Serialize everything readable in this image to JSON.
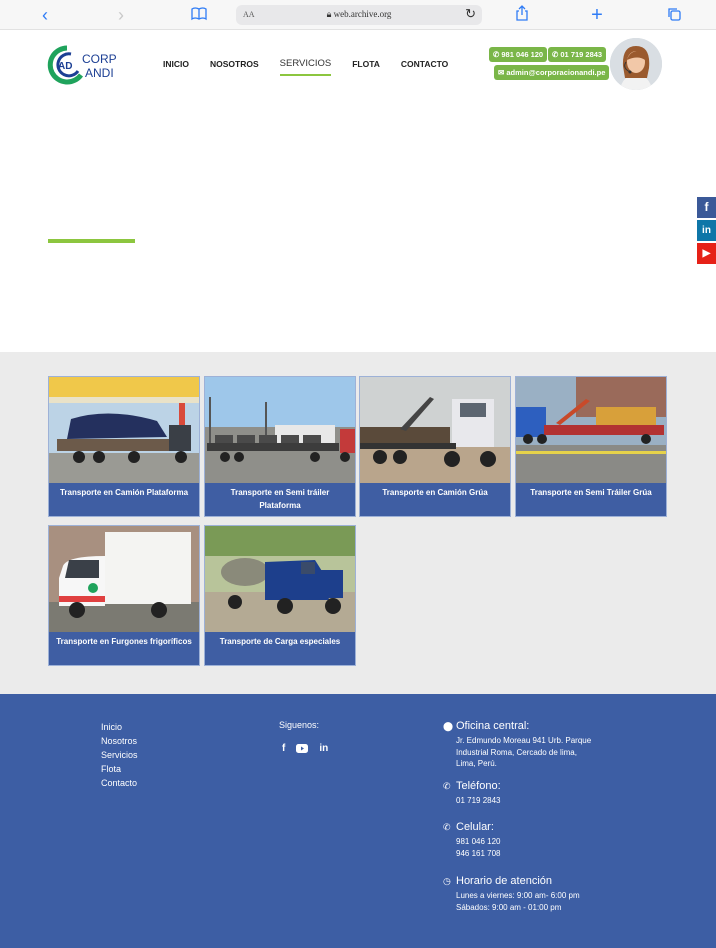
{
  "browser": {
    "text_size": "AA",
    "url": "web.archive.org"
  },
  "logo": {
    "text_top": "CORP",
    "text_bottom": "ANDI",
    "mark": "AD"
  },
  "nav": {
    "items": [
      "INICIO",
      "NOSOTROS",
      "SERVICIOS",
      "FLOTA",
      "CONTACTO"
    ],
    "active": "SERVICIOS"
  },
  "contact_pills": {
    "whatsapp": "981 046 120",
    "phone": "01 719 2843",
    "email": "admin@corporacionandi.pe"
  },
  "social_side": [
    "f",
    "in",
    "▶"
  ],
  "services": [
    "Transporte en Camión Plataforma",
    "Transporte en Semi tráiler Plataforma",
    "Transporte en Camión Grúa",
    "Transporte en Semi Tráiler Grúa",
    "Transporte en Furgones frigoríficos",
    "Transporte de Carga especiales"
  ],
  "footer": {
    "links": [
      "Inicio",
      "Nosotros",
      "Servicios",
      "Flota",
      "Contacto"
    ],
    "follow_label": "Siguenos:",
    "office_title": "Oficina central:",
    "office_lines": [
      "Jr. Edmundo Moreau 941 Urb. Parque",
      "Industrial Roma, Cercado de lima,",
      "Lima, Perú."
    ],
    "phone_title": "Teléfono:",
    "phone_lines": [
      "01 719 2843"
    ],
    "mobile_title": "Celular:",
    "mobile_lines": [
      "981 046 120",
      "946 161 708"
    ],
    "hours_title": "Horario de atención",
    "hours_lines": [
      "Lunes a viernes: 9:00 am- 6:00 pm",
      "Sábados: 9:00 am - 01:00 pm"
    ]
  },
  "colors": {
    "green": "#8cc63f",
    "blue": "#3d5ea4",
    "browser_accent": "#2f7cf6"
  }
}
